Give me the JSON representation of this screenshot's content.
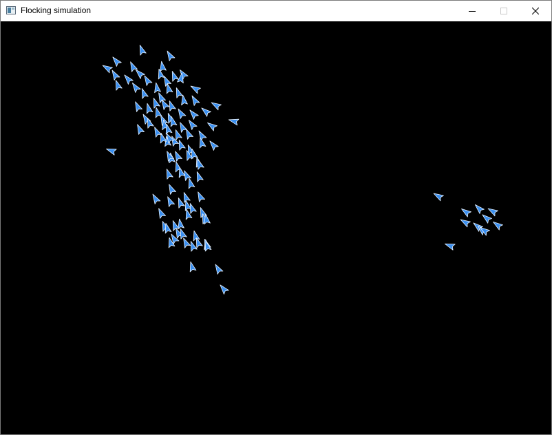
{
  "window": {
    "title": "Flocking simulation",
    "app_icon": "window-app-icon",
    "controls": {
      "minimize_icon": "minimize-icon",
      "maximize_icon": "maximize-icon",
      "close_icon": "close-icon"
    }
  },
  "canvas": {
    "background": "#000000",
    "boid_fill": "#3a8ff0",
    "boid_stroke": "#e6f2ff",
    "boid_count": 115
  }
}
